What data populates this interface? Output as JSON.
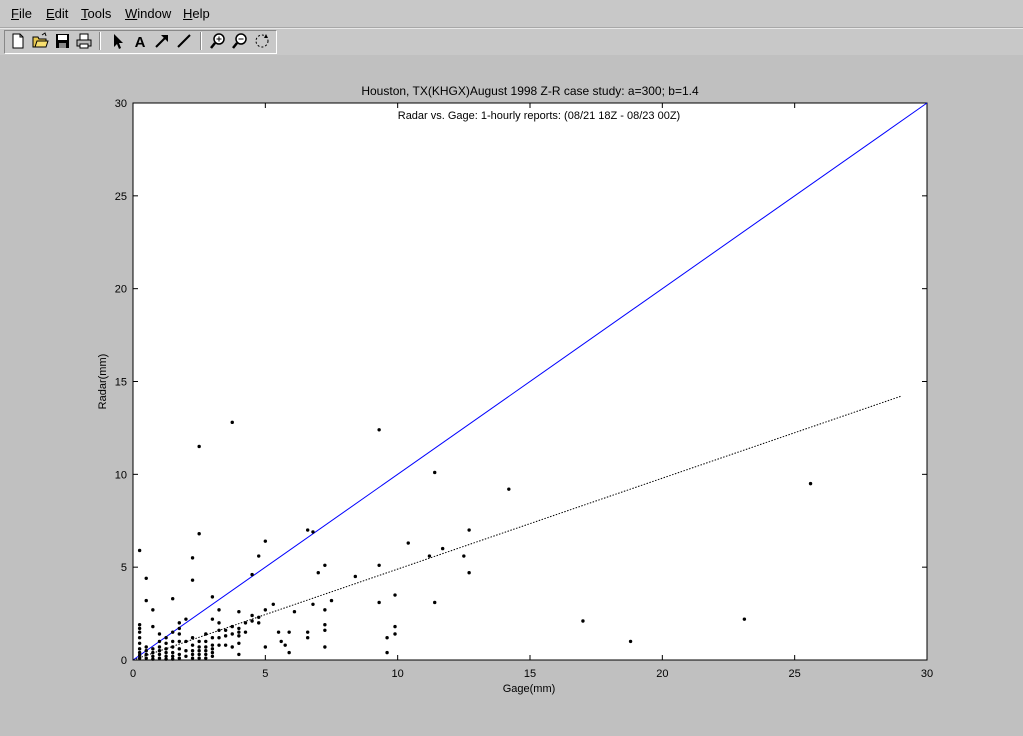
{
  "menu": [
    {
      "pre": "",
      "ul": "F",
      "post": "ile"
    },
    {
      "pre": "",
      "ul": "E",
      "post": "dit"
    },
    {
      "pre": "",
      "ul": "T",
      "post": "ools"
    },
    {
      "pre": "",
      "ul": "W",
      "post": "indow"
    },
    {
      "pre": "",
      "ul": "H",
      "post": "elp"
    }
  ],
  "toolbar": {
    "buttons": [
      "new-figure-icon",
      "open-folder-icon",
      "save-icon",
      "print-icon",
      "arrow-select-icon",
      "text-tool-icon",
      "arrow-tool-icon",
      "line-tool-icon",
      "zoom-in-icon",
      "zoom-out-icon",
      "rotate-icon"
    ]
  },
  "chart_data": {
    "type": "scatter",
    "title": "Houston, TX(KHGX)August 1998 Z-R case study: a=300; b=1.4",
    "subtitle": "Radar vs. Gage: 1-hourly reports: (08/21 18Z - 08/23 00Z)",
    "xlabel": "Gage(mm)",
    "ylabel": "Radar(mm)",
    "xlim": [
      0,
      30
    ],
    "ylim": [
      0,
      30
    ],
    "xticks": [
      "0",
      "5",
      "10",
      "15",
      "20",
      "25",
      "30"
    ],
    "yticks": [
      "0",
      "5",
      "10",
      "15",
      "20",
      "25",
      "30"
    ],
    "grid": false,
    "lines": [
      {
        "style": "solid",
        "color": "#0000ff",
        "x": [
          0,
          30
        ],
        "y": [
          0,
          30
        ]
      },
      {
        "style": "dotted",
        "color": "#000000",
        "x": [
          0,
          29
        ],
        "y": [
          0,
          14.2
        ]
      }
    ],
    "points": [
      [
        0.25,
        5.9
      ],
      [
        0.25,
        1.9
      ],
      [
        0.25,
        1.7
      ],
      [
        0.25,
        1.5
      ],
      [
        0.25,
        1.2
      ],
      [
        0.25,
        0.9
      ],
      [
        0.25,
        0.6
      ],
      [
        0.25,
        0.4
      ],
      [
        0.25,
        0.25
      ],
      [
        0.25,
        0.1
      ],
      [
        0.5,
        4.4
      ],
      [
        0.5,
        3.2
      ],
      [
        0.5,
        0.7
      ],
      [
        0.5,
        0.5
      ],
      [
        0.5,
        0.3
      ],
      [
        0.5,
        0.1
      ],
      [
        0.75,
        2.7
      ],
      [
        0.75,
        1.8
      ],
      [
        0.75,
        0.6
      ],
      [
        0.75,
        0.4
      ],
      [
        0.75,
        0.2
      ],
      [
        0.75,
        0.05
      ],
      [
        1.0,
        1.4
      ],
      [
        1.0,
        1.0
      ],
      [
        1.0,
        0.7
      ],
      [
        1.0,
        0.5
      ],
      [
        1.0,
        0.3
      ],
      [
        1.0,
        0.1
      ],
      [
        1.25,
        1.2
      ],
      [
        1.25,
        0.9
      ],
      [
        1.25,
        0.6
      ],
      [
        1.25,
        0.4
      ],
      [
        1.25,
        0.2
      ],
      [
        1.25,
        0.05
      ],
      [
        1.5,
        3.3
      ],
      [
        1.5,
        1.5
      ],
      [
        1.5,
        1.0
      ],
      [
        1.5,
        0.7
      ],
      [
        1.5,
        0.4
      ],
      [
        1.5,
        0.2
      ],
      [
        1.5,
        0.05
      ],
      [
        1.75,
        2.0
      ],
      [
        1.75,
        1.7
      ],
      [
        1.75,
        1.4
      ],
      [
        1.75,
        1.0
      ],
      [
        1.75,
        0.6
      ],
      [
        1.75,
        0.3
      ],
      [
        1.75,
        0.1
      ],
      [
        2.0,
        2.2
      ],
      [
        2.0,
        1.0
      ],
      [
        2.0,
        0.5
      ],
      [
        2.0,
        0.2
      ],
      [
        2.25,
        5.5
      ],
      [
        2.25,
        4.3
      ],
      [
        2.25,
        1.2
      ],
      [
        2.25,
        0.8
      ],
      [
        2.25,
        0.5
      ],
      [
        2.25,
        0.3
      ],
      [
        2.25,
        0.1
      ],
      [
        2.5,
        11.5
      ],
      [
        2.5,
        6.8
      ],
      [
        2.5,
        1.0
      ],
      [
        2.5,
        0.7
      ],
      [
        2.5,
        0.5
      ],
      [
        2.5,
        0.3
      ],
      [
        2.5,
        0.1
      ],
      [
        2.75,
        1.4
      ],
      [
        2.75,
        1.0
      ],
      [
        2.75,
        0.7
      ],
      [
        2.75,
        0.5
      ],
      [
        2.75,
        0.3
      ],
      [
        2.75,
        0.1
      ],
      [
        3.0,
        3.4
      ],
      [
        3.0,
        2.2
      ],
      [
        3.0,
        1.2
      ],
      [
        3.0,
        0.8
      ],
      [
        3.0,
        0.6
      ],
      [
        3.0,
        0.4
      ],
      [
        3.0,
        0.2
      ],
      [
        3.25,
        2.7
      ],
      [
        3.25,
        2.0
      ],
      [
        3.25,
        1.6
      ],
      [
        3.25,
        1.2
      ],
      [
        3.25,
        0.8
      ],
      [
        3.5,
        1.6
      ],
      [
        3.5,
        1.3
      ],
      [
        3.5,
        0.8
      ],
      [
        3.75,
        12.8
      ],
      [
        3.75,
        1.8
      ],
      [
        3.75,
        1.4
      ],
      [
        3.75,
        0.7
      ],
      [
        4.0,
        2.6
      ],
      [
        4.0,
        1.7
      ],
      [
        4.0,
        1.5
      ],
      [
        4.0,
        1.3
      ],
      [
        4.0,
        0.9
      ],
      [
        4.0,
        0.3
      ],
      [
        4.25,
        2.0
      ],
      [
        4.25,
        1.5
      ],
      [
        4.5,
        4.6
      ],
      [
        4.5,
        2.4
      ],
      [
        4.5,
        2.1
      ],
      [
        4.75,
        5.6
      ],
      [
        4.75,
        2.3
      ],
      [
        4.75,
        2.0
      ],
      [
        5.0,
        6.4
      ],
      [
        5.0,
        2.7
      ],
      [
        5.0,
        0.7
      ],
      [
        5.3,
        3.0
      ],
      [
        5.5,
        1.5
      ],
      [
        5.6,
        1.0
      ],
      [
        5.75,
        0.8
      ],
      [
        5.9,
        1.5
      ],
      [
        5.9,
        0.4
      ],
      [
        6.1,
        2.6
      ],
      [
        6.6,
        1.5
      ],
      [
        6.6,
        1.2
      ],
      [
        6.6,
        7.0
      ],
      [
        6.8,
        6.9
      ],
      [
        6.8,
        3.0
      ],
      [
        7.0,
        4.7
      ],
      [
        7.25,
        5.1
      ],
      [
        7.25,
        2.7
      ],
      [
        7.25,
        1.9
      ],
      [
        7.25,
        1.6
      ],
      [
        7.25,
        0.7
      ],
      [
        7.5,
        3.2
      ],
      [
        8.4,
        4.5
      ],
      [
        9.3,
        12.4
      ],
      [
        9.3,
        5.1
      ],
      [
        9.3,
        3.1
      ],
      [
        9.6,
        1.2
      ],
      [
        9.6,
        0.4
      ],
      [
        9.9,
        3.5
      ],
      [
        9.9,
        1.8
      ],
      [
        9.9,
        1.4
      ],
      [
        10.4,
        6.3
      ],
      [
        11.2,
        5.6
      ],
      [
        11.4,
        10.1
      ],
      [
        11.4,
        3.1
      ],
      [
        11.7,
        6.0
      ],
      [
        12.5,
        5.6
      ],
      [
        12.7,
        7.0
      ],
      [
        12.7,
        4.7
      ],
      [
        14.2,
        9.2
      ],
      [
        17.0,
        2.1
      ],
      [
        18.8,
        1.0
      ],
      [
        23.1,
        2.2
      ],
      [
        25.6,
        9.5
      ]
    ]
  }
}
